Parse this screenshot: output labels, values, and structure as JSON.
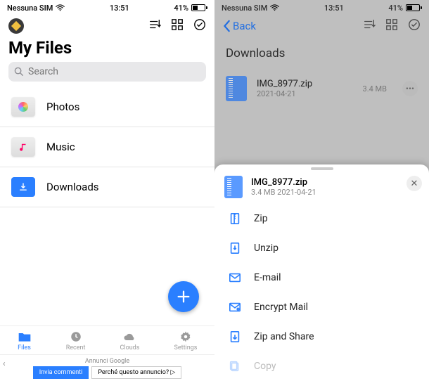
{
  "status": {
    "carrier": "Nessuna SIM",
    "time": "13:51",
    "battery": "41%"
  },
  "left": {
    "title": "My Files",
    "search_placeholder": "Search",
    "items": [
      {
        "label": "Photos"
      },
      {
        "label": "Music"
      },
      {
        "label": "Downloads"
      }
    ],
    "tabs": [
      {
        "label": "Files"
      },
      {
        "label": "Recent"
      },
      {
        "label": "Clouds"
      },
      {
        "label": "Settings"
      }
    ],
    "ad": {
      "label": "Annunci Google",
      "btn1": "Invia commenti",
      "btn2": "Perché questo annuncio? ▷"
    }
  },
  "right": {
    "back": "Back",
    "title": "Downloads",
    "file": {
      "name": "IMG_8977.zip",
      "date": "2021-04-21",
      "size": "3.4 MB"
    },
    "sheet": {
      "name": "IMG_8977.zip",
      "sub": "3.4 MB 2021-04-21",
      "actions": [
        {
          "label": "Zip"
        },
        {
          "label": "Unzip"
        },
        {
          "label": "E-mail"
        },
        {
          "label": "Encrypt Mail"
        },
        {
          "label": "Zip and Share"
        },
        {
          "label": "Copy"
        }
      ]
    }
  }
}
